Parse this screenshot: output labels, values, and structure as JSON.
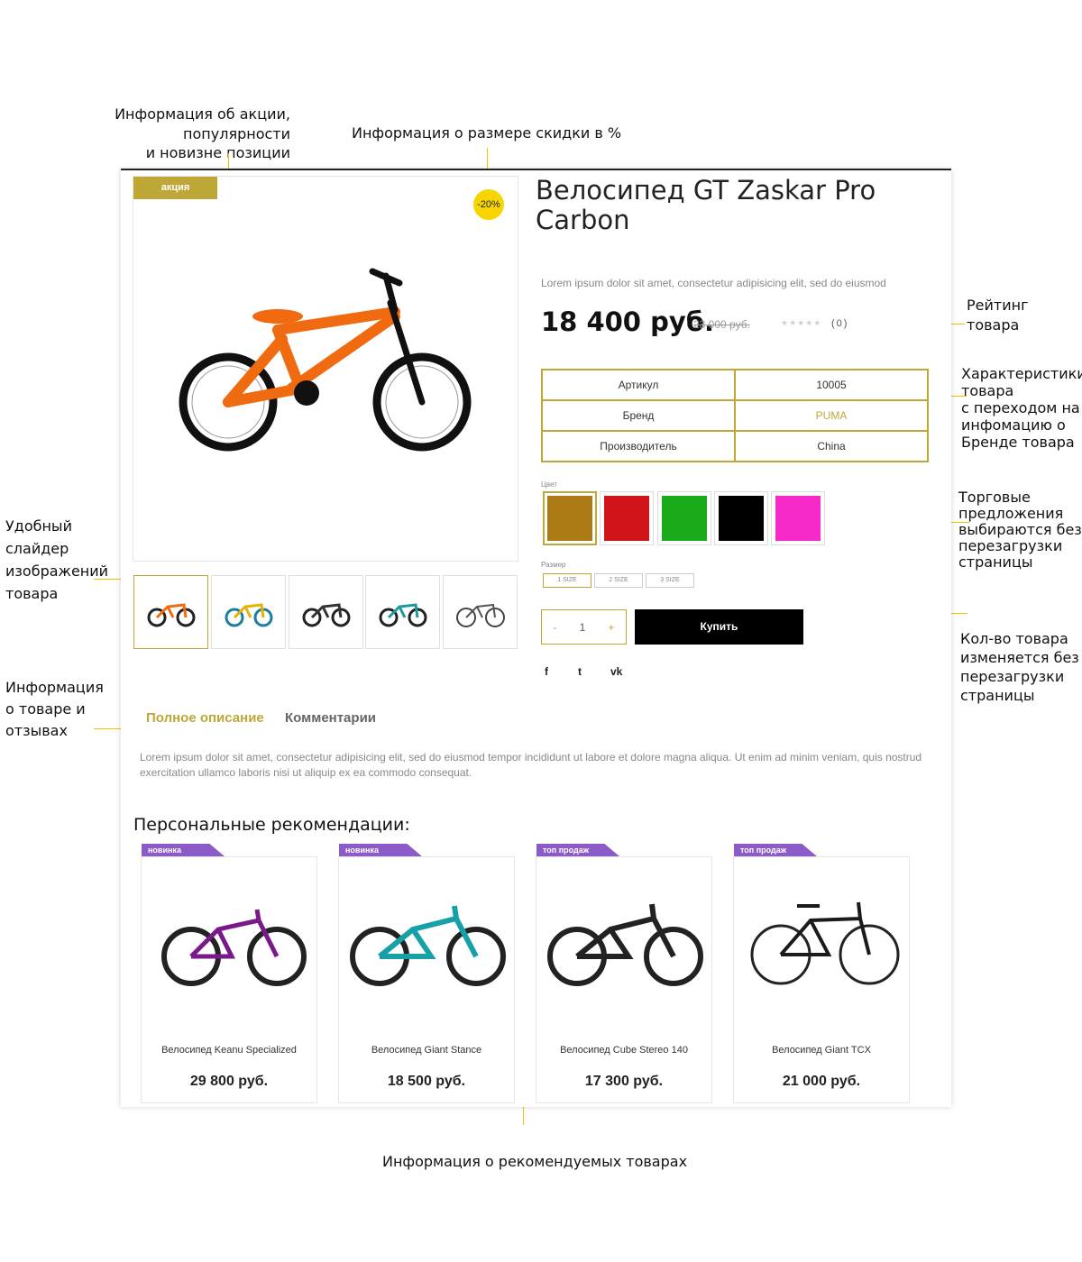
{
  "annotations": {
    "promo": "Информация об акции, популярности\nи новизне позиции",
    "discount": "Информация о размере скидки в %",
    "rating": "Рейтинг\nтовара",
    "specs": "Характеристики\nтовара\nс переходом на\nинфомацию о\nБренде товара",
    "offers": "Торговые\nпредложения\nвыбираются без\nперезагрузки\nстраницы",
    "qty": "Кол-во товара\nизменяется без\nперезагрузки\nстраницы",
    "slider": "Удобный\nслайдер\nизображений\nтовара",
    "info": "Информация\nо товаре и\nотзывах",
    "recommended": "Информация о рекомендуемых товарах"
  },
  "product": {
    "sale_badge": "акция",
    "discount_badge": "-20%",
    "title": "Велосипед GT Zaskar Pro Carbon",
    "description": "Lorem ipsum dolor sit amet, consectetur adipisicing elit, sed do eiusmod",
    "price": "18 400 руб.",
    "old_price": "23 000 руб.",
    "rating_stars": "★★★★★",
    "rating_count": "(0)",
    "specs": [
      {
        "label": "Артикул",
        "value": "10005"
      },
      {
        "label": "Бренд",
        "value": "PUMA"
      },
      {
        "label": "Производитель",
        "value": "China"
      }
    ],
    "color_label": "Цвет",
    "colors": [
      "#ab7a14",
      "#d0141a",
      "#1aab1a",
      "#000000",
      "#f729c9"
    ],
    "size_label": "Размер",
    "sizes": [
      "1 SIZE",
      "2 SIZE",
      "3 SIZE"
    ],
    "qty_minus": "-",
    "qty_value": "1",
    "qty_plus": "+",
    "buy_label": "Купить",
    "social": {
      "facebook": "f",
      "twitter": "t",
      "vk": "vk"
    }
  },
  "thumbnails": [
    "#f06a10",
    "#e8b000",
    "#333333",
    "#1a9aa0",
    "#555555"
  ],
  "tabs": {
    "description_tab": "Полное описание",
    "comments_tab": "Комментарии",
    "text": "Lorem ipsum dolor sit amet, consectetur adipisicing elit, sed do eiusmod tempor incididunt ut labore et dolore magna aliqua. Ut enim ad minim veniam, quis nostrud exercitation ullamco laboris nisi ut aliquip ex ea commodo consequat."
  },
  "recommendations": {
    "title": "Персональные рекомендации:",
    "items": [
      {
        "flag": "новинка",
        "name": "Велосипед Keanu Specialized",
        "price": "29 800 руб.",
        "frame_color": "#7a1a8a"
      },
      {
        "flag": "новинка",
        "name": "Велосипед Giant Stance",
        "price": "18 500 руб.",
        "frame_color": "#18a0a8"
      },
      {
        "flag": "топ продаж",
        "name": "Велосипед Cube Stereo 140",
        "price": "17 300 руб.",
        "frame_color": "#222222"
      },
      {
        "flag": "топ продаж",
        "name": "Велосипед Giant TCX",
        "price": "21 000 руб.",
        "frame_color": "#1a1a1a"
      }
    ]
  },
  "accent_color": "#bfa737",
  "annotation_color": "#f2c200"
}
